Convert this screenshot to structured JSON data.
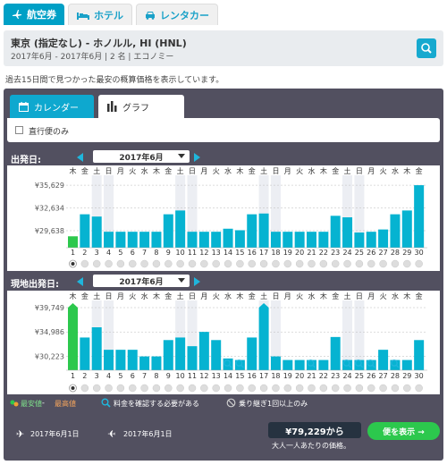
{
  "top_tabs": [
    {
      "label": "航空券",
      "icon": "plane-icon",
      "active": true
    },
    {
      "label": "ホテル",
      "icon": "bed-icon",
      "active": false
    },
    {
      "label": "レンタカー",
      "icon": "car-icon",
      "active": false
    }
  ],
  "route": {
    "title": "東京 (指定なし) - ホノルル, HI (HNL)",
    "subtitle": "2017年6月 - 2017年6月 | 2 名 | エコノミー"
  },
  "note": "過去15日間で見つかった最安の概算価格を表示しています。",
  "view_tabs": {
    "calendar": "カレンダー",
    "graph": "グラフ"
  },
  "direct_only_label": "直行便のみ",
  "departure": {
    "label": "出発日:",
    "month": "2017年6月",
    "ticks": [
      "¥35,629",
      "¥32,634",
      "¥29,638"
    ]
  },
  "return": {
    "label": "現地出発日:",
    "month": "2017年6月",
    "ticks": [
      "¥39,749",
      "¥34,986",
      "¥30,223"
    ]
  },
  "weekdays": [
    "木",
    "金",
    "土",
    "日",
    "月",
    "火",
    "水",
    "木",
    "金",
    "土",
    "日",
    "月",
    "火",
    "水",
    "木",
    "金",
    "土",
    "日",
    "月",
    "火",
    "水",
    "木",
    "金",
    "土",
    "日",
    "月",
    "火",
    "水",
    "木",
    "金"
  ],
  "days": [
    "1",
    "2",
    "3",
    "4",
    "5",
    "6",
    "7",
    "8",
    "9",
    "10",
    "11",
    "12",
    "13",
    "14",
    "15",
    "16",
    "17",
    "18",
    "19",
    "20",
    "21",
    "22",
    "23",
    "24",
    "25",
    "26",
    "27",
    "28",
    "29",
    "30"
  ],
  "legend": {
    "cheapest": "最安値",
    "separator": " - ",
    "highest": "最高値",
    "check": "料金を確認する必要がある",
    "one_stop": "乗り継ぎ1回以上のみ"
  },
  "footer": {
    "outbound_date": "2017年6月1日",
    "return_date": "2017年6月1日",
    "price": "¥79,229から",
    "price_note": "大人一人あたりの価格。",
    "show_button": "便を表示 →"
  },
  "colors": {
    "bar": "#06b3d1",
    "bar_cheapest": "#2cc84d",
    "weekend": "#eceef3"
  },
  "chart_data": [
    {
      "type": "bar",
      "name": "departure",
      "categories": [
        "1",
        "2",
        "3",
        "4",
        "5",
        "6",
        "7",
        "8",
        "9",
        "10",
        "11",
        "12",
        "13",
        "14",
        "15",
        "16",
        "17",
        "18",
        "19",
        "20",
        "21",
        "22",
        "23",
        "24",
        "25",
        "26",
        "27",
        "28",
        "29",
        "30"
      ],
      "values": [
        28900,
        31800,
        31500,
        29500,
        29500,
        29500,
        29500,
        29500,
        31800,
        32300,
        29500,
        29500,
        29500,
        29900,
        29700,
        31800,
        31900,
        29500,
        29500,
        29500,
        29500,
        29500,
        31600,
        31400,
        29400,
        29500,
        29800,
        31800,
        32300,
        35629
      ],
      "ylim": [
        27400,
        36700
      ],
      "cheapest_index": 0,
      "selected_index": 0
    },
    {
      "type": "bar",
      "name": "return",
      "categories": [
        "1",
        "2",
        "3",
        "4",
        "5",
        "6",
        "7",
        "8",
        "9",
        "10",
        "11",
        "12",
        "13",
        "14",
        "15",
        "16",
        "17",
        "18",
        "19",
        "20",
        "21",
        "22",
        "23",
        "24",
        "25",
        "26",
        "27",
        "28",
        "29",
        "30"
      ],
      "values": [
        39749,
        33900,
        35900,
        31500,
        31500,
        31500,
        30200,
        30200,
        33400,
        33900,
        32200,
        35000,
        33400,
        29800,
        29500,
        33900,
        39749,
        30200,
        29500,
        29500,
        29500,
        29500,
        34000,
        29500,
        29500,
        29500,
        31500,
        29500,
        29500,
        33400
      ],
      "ylim": [
        27500,
        40800
      ],
      "cheapest_index": 0,
      "selected_index": 0,
      "check_price_days": [
        "14",
        "15",
        "21",
        "24",
        "25",
        "26",
        "28"
      ]
    }
  ]
}
